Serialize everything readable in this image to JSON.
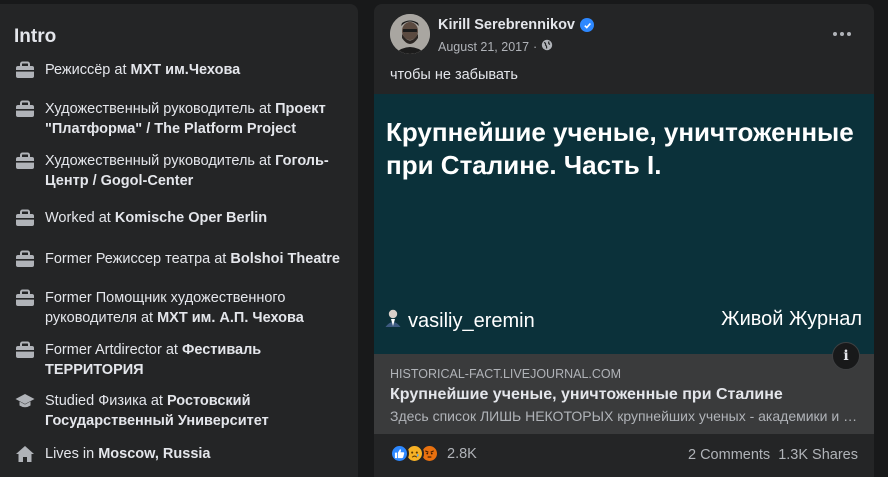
{
  "intro": {
    "title": "Intro",
    "items": [
      {
        "icon": "briefcase-icon",
        "prefix": "Режиссёр at ",
        "bold": "МХТ им.Чехова"
      },
      {
        "icon": "briefcase-icon",
        "prefix": "Художественный руководитель at ",
        "bold": "Проект \"Платформа\" / The Platform Project"
      },
      {
        "icon": "briefcase-icon",
        "prefix": "Художественный руководитель at ",
        "bold": "Гоголь-Центр / Gogol-Center"
      },
      {
        "icon": "briefcase-icon",
        "prefix": "Worked at ",
        "bold": "Komische Oper Berlin"
      },
      {
        "icon": "briefcase-icon",
        "prefix": "Former Режиссер театра at ",
        "bold": "Bolshoi Theatre"
      },
      {
        "icon": "briefcase-icon",
        "prefix": "Former Помощник художественного руководителя at ",
        "bold": "МХТ им. А.П. Чехова"
      },
      {
        "icon": "briefcase-icon",
        "prefix": "Former Artdirector at ",
        "bold": "Фестиваль ТЕРРИТОРИЯ"
      },
      {
        "icon": "graduation-cap-icon",
        "prefix": "Studied Физика at ",
        "bold": "Ростовский Государственный Университет"
      },
      {
        "icon": "home-icon",
        "prefix": "Lives in ",
        "bold": "Moscow, Russia"
      }
    ]
  },
  "post": {
    "author": "Kirill Serebrennikov",
    "date": "August 21, 2017",
    "date_separator": "·",
    "audience_icon": "public-globe-icon",
    "caption": "чтобы не забывать",
    "image": {
      "title": "Крупнейшие ученые, уничтоженные при Сталине. Часть I.",
      "username": "vasiliy_eremin",
      "source": "Живой Журнал"
    },
    "link": {
      "domain": "HISTORICAL-FACT.LIVEJOURNAL.COM",
      "title": "Крупнейшие ученые, уничтоженные при Сталине",
      "description": "Здесь список ЛИШЬ НЕКОТОРЫХ крупнейших ученых - академики и члены-корреспонденты АН СССР",
      "info_label": "i"
    },
    "reactions": {
      "icons": [
        "like-icon",
        "sad-icon",
        "angry-icon"
      ],
      "count": "2.8K"
    },
    "comments": "2 Comments",
    "shares": "1.3K Shares"
  },
  "colors": {
    "background": "#18191a",
    "card": "#242526",
    "image_bg": "#0b313a",
    "link_box": "#3a3b3c",
    "accent": "#2d88ff"
  }
}
